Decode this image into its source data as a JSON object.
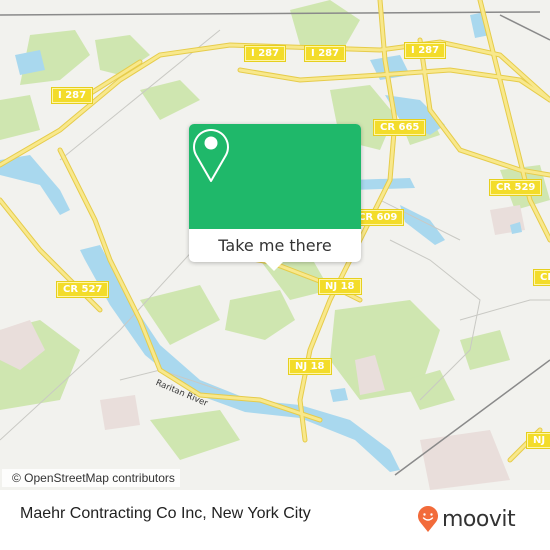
{
  "map": {
    "road_shields": [
      {
        "label": "I 287",
        "id": "i287-west"
      },
      {
        "label": "I 287",
        "id": "i287-center"
      },
      {
        "label": "I 287",
        "id": "i287-north"
      },
      {
        "label": "I 287",
        "id": "i287-northeast"
      },
      {
        "label": "CR 665",
        "id": "cr665"
      },
      {
        "label": "CR 609",
        "id": "cr609"
      },
      {
        "label": "CR 529",
        "id": "cr529"
      },
      {
        "label": "CR 527",
        "id": "cr527"
      },
      {
        "label": "NJ 18",
        "id": "nj18-north"
      },
      {
        "label": "NJ 18",
        "id": "nj18-south"
      },
      {
        "label": "CR",
        "id": "cr-east-edge"
      },
      {
        "label": "NJ",
        "id": "nj-southeast-edge"
      }
    ],
    "water_labels": [
      "Raritan River"
    ],
    "colors": {
      "land": "#f2f2ee",
      "park": "#cfe6b0",
      "water": "#a9d8ee",
      "road": "#f6e27a",
      "shield": "#f3dc2a",
      "popup_accent": "#1fb86a"
    }
  },
  "popup": {
    "icon": "location-pin-icon",
    "action_label": "Take me there"
  },
  "attribution": "© OpenStreetMap contributors",
  "footer": {
    "place_title": "Maehr Contracting Co Inc, New York City",
    "brand": "moovit",
    "brand_color": "#f26b3a"
  }
}
